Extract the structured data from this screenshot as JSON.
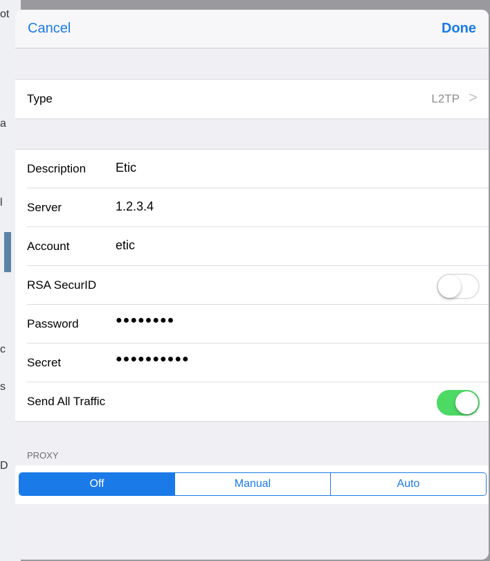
{
  "background_app": {
    "fragments": [
      "ot",
      "a",
      "l",
      "c",
      "s",
      "D"
    ]
  },
  "nav": {
    "cancel_label": "Cancel",
    "done_label": "Done"
  },
  "type_row": {
    "label": "Type",
    "value": "L2TP",
    "chevron": ">"
  },
  "fields": {
    "description": {
      "label": "Description",
      "value": "Etic"
    },
    "server": {
      "label": "Server",
      "value": "1.2.3.4"
    },
    "account": {
      "label": "Account",
      "value": "etic"
    },
    "rsa": {
      "label": "RSA SecurID",
      "enabled": false
    },
    "password": {
      "label": "Password",
      "value": "●●●●●●●●"
    },
    "secret": {
      "label": "Secret",
      "value": "●●●●●●●●●●"
    },
    "send_all": {
      "label": "Send All Traffic",
      "enabled": true
    }
  },
  "proxy": {
    "header": "PROXY",
    "options": [
      "Off",
      "Manual",
      "Auto"
    ],
    "selected": "Off"
  },
  "colors": {
    "accent": "#1a7ae8",
    "toggle_on": "#4cd964",
    "grouped_background": "#efeff4"
  }
}
